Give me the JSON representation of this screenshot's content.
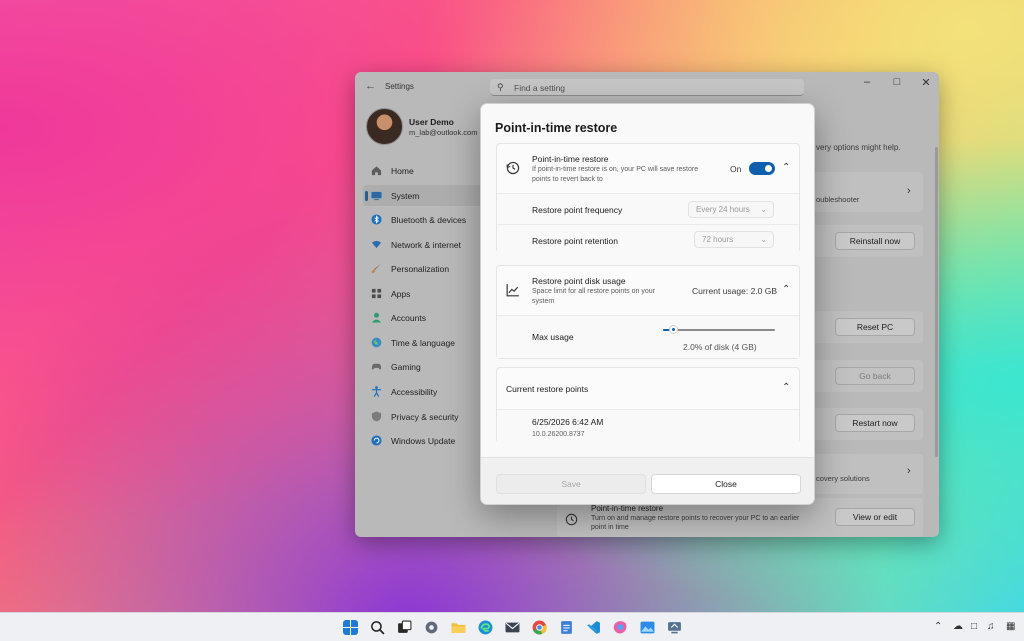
{
  "settings": {
    "app_title": "Settings",
    "search_placeholder": "Find a setting",
    "user": {
      "name": "User Demo",
      "email": "m_lab@outlook.com"
    },
    "nav": [
      {
        "label": "Home",
        "icon": "home-icon"
      },
      {
        "label": "System",
        "icon": "system-icon",
        "selected": true
      },
      {
        "label": "Bluetooth & devices",
        "icon": "bluetooth-icon"
      },
      {
        "label": "Network & internet",
        "icon": "wifi-icon"
      },
      {
        "label": "Personalization",
        "icon": "brush-icon"
      },
      {
        "label": "Apps",
        "icon": "apps-icon"
      },
      {
        "label": "Accounts",
        "icon": "accounts-icon"
      },
      {
        "label": "Time & language",
        "icon": "globe-icon"
      },
      {
        "label": "Gaming",
        "icon": "gaming-icon"
      },
      {
        "label": "Accessibility",
        "icon": "accessibility-icon"
      },
      {
        "label": "Privacy & security",
        "icon": "shield-icon"
      },
      {
        "label": "Windows Update",
        "icon": "update-icon"
      }
    ],
    "content": {
      "help_text": "very options might help.",
      "troubleshooter_text": "oubleshooter",
      "reinstall_button": "Reinstall now",
      "reset_button": "Reset PC",
      "go_back_button": "Go back",
      "restart_button": "Restart now",
      "recovery_solutions_text": "covery solutions",
      "pitr_title": "Point-in-time restore",
      "pitr_desc_1": "Turn on and manage restore points to recover your PC to an earlier",
      "pitr_desc_2": "point in time",
      "view_edit_button": "View or edit"
    }
  },
  "dialog": {
    "title": "Point-in-time restore",
    "restore_section": {
      "title": "Point-in-time restore",
      "description_1": "If point-in-time restore is on, your PC will save restore",
      "description_2": "points to revert back to",
      "toggle_label": "On",
      "toggle_on": true,
      "frequency_label": "Restore point frequency",
      "frequency_value": "Every 24 hours",
      "retention_label": "Restore point retention",
      "retention_value": "72 hours"
    },
    "disk_section": {
      "title": "Restore point disk usage",
      "description_1": "Space limit for all restore points on your",
      "description_2": "system",
      "current_usage": "Current usage: 2.0 GB",
      "max_usage_label": "Max usage",
      "max_usage_value": "2.0% of disk (4 GB)",
      "slider_fraction": 0.02
    },
    "points_section": {
      "title": "Current restore points",
      "points": [
        {
          "date": "6/25/2026 6:42 AM",
          "version": "10.0.26200.8737"
        }
      ]
    },
    "save_button": "Save",
    "close_button": "Close"
  },
  "taskbar": {
    "apps": [
      "start-icon",
      "search-icon",
      "task-view-icon",
      "settings-icon",
      "file-explorer-icon",
      "edge-icon",
      "mail-icon",
      "chrome-icon",
      "notepad-icon",
      "vscode-icon",
      "copilot-icon",
      "photos-icon",
      "remote-desktop-icon"
    ],
    "accent": "#0f5fad"
  }
}
